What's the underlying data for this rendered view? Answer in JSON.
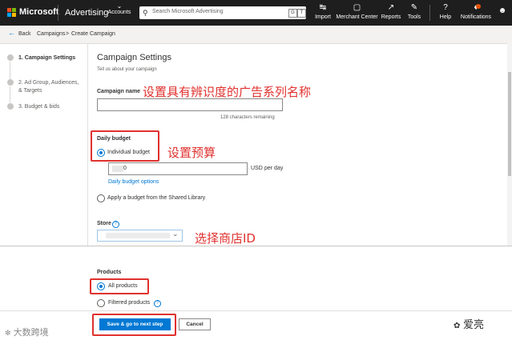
{
  "topbar": {
    "brand": "Microsoft",
    "product": "Advertising",
    "accounts_label": "Accounts",
    "search_placeholder": "Search Microsoft Advertising",
    "search_key1": "G",
    "search_key2": "T",
    "nav": [
      {
        "label": "Import",
        "icon": "import-icon"
      },
      {
        "label": "Merchant Center",
        "icon": "merchant-center-icon"
      },
      {
        "label": "Reports",
        "icon": "reports-icon"
      },
      {
        "label": "Tools",
        "icon": "tools-icon"
      },
      {
        "label": "Help",
        "icon": "help-icon"
      },
      {
        "label": "Notifications",
        "icon": "bell-icon"
      }
    ],
    "colors": {
      "bar": "#1e1e1e",
      "notify_dot": "#e65100"
    }
  },
  "breadcrumb": {
    "back": "Back",
    "campaigns": "Campaigns",
    "separator": ">",
    "current": "Create Campaign"
  },
  "steps": [
    {
      "label": "1. Campaign Settings",
      "active": true
    },
    {
      "label": "2. Ad Group, Audiences, & Targets",
      "active": false
    },
    {
      "label": "3. Budget & bids",
      "active": false
    }
  ],
  "content": {
    "title": "Campaign Settings",
    "subtitle": "Tell us about your campaign",
    "campaign_name_label": "Campaign name",
    "chars_remaining": "128 characters remaining",
    "daily_budget_label": "Daily budget",
    "individual_budget": "Individual budget",
    "budget_value": "0",
    "currency": "USD",
    "per_day": "per day",
    "daily_budget_options": "Daily budget options",
    "shared_library": "Apply a budget from the Shared Library",
    "store_label": "Store",
    "products_label": "Products",
    "all_products": "All products",
    "filtered_products": "Filtered products",
    "save_button": "Save & go to next step",
    "cancel_button": "Cancel"
  },
  "annotations": {
    "name": "设置具有辨识度的广告系列名称",
    "budget": "设置预算",
    "store": "选择商店ID",
    "color": "#e0312e"
  },
  "watermarks": {
    "left": "大数跨境",
    "right": "爱亮"
  },
  "accent": "#0078d4"
}
